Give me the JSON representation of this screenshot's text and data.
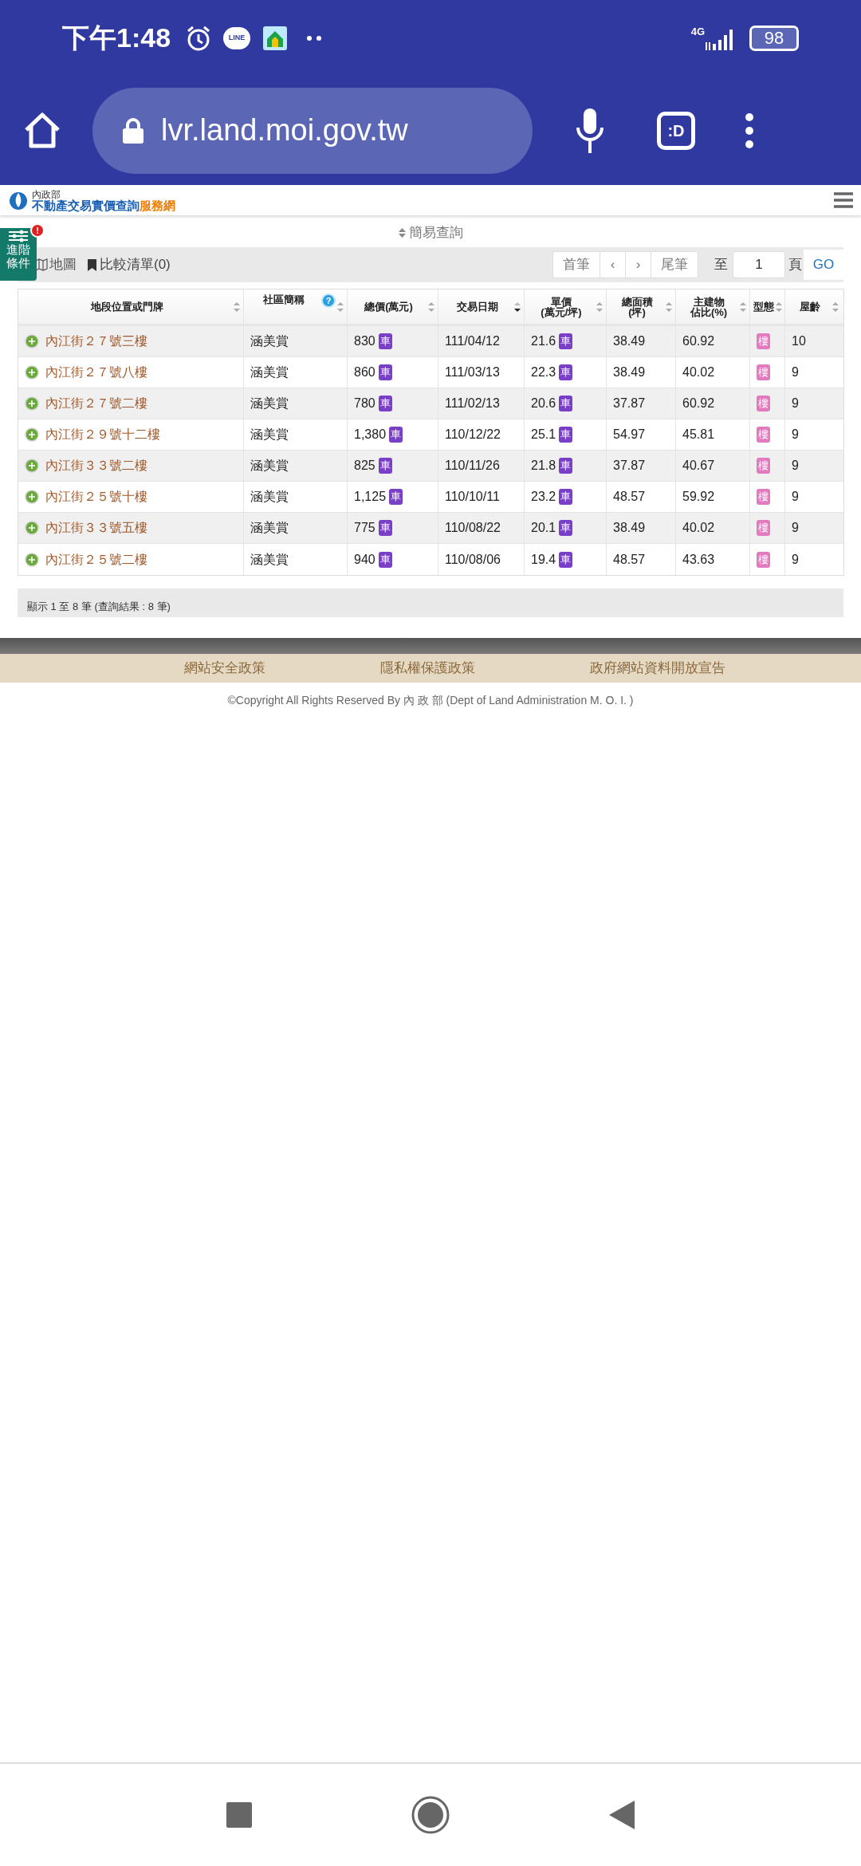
{
  "status_bar": {
    "time": "下午1:48",
    "chat_app": "LINE",
    "network": "4G",
    "battery": "98"
  },
  "browser": {
    "url": "lvr.land.moi.gov.tw",
    "tab_switcher": ":D"
  },
  "site_header": {
    "ministry": "內政部",
    "title": "不動產交易實價查詢",
    "title_suffix": "服務網"
  },
  "advanced_button": {
    "lines": [
      "進階",
      "條件"
    ],
    "alert": "!"
  },
  "simple_query": "簡易查詢",
  "toolbar": {
    "map": "地圖",
    "compare": "比較清單(0)",
    "first": "首筆",
    "prev": "‹",
    "next": "›",
    "last": "尾筆",
    "goto_label": "至",
    "page": "1",
    "page_unit": "頁",
    "go": "GO"
  },
  "table": {
    "columns": [
      {
        "lines": [
          "地段位置或門牌"
        ],
        "sorted": false
      },
      {
        "lines": [
          "社區簡稱"
        ],
        "sorted": false,
        "help": "?"
      },
      {
        "lines": [
          "總價(萬元)"
        ],
        "sorted": false
      },
      {
        "lines": [
          "交易日期"
        ],
        "sorted": true
      },
      {
        "lines": [
          "單價",
          "(萬元/坪)"
        ],
        "sorted": false
      },
      {
        "lines": [
          "總面積",
          "(坪)"
        ],
        "sorted": false
      },
      {
        "lines": [
          "主建物",
          "佔比(%)"
        ],
        "sorted": false
      },
      {
        "lines": [
          "型態"
        ],
        "sorted": false
      },
      {
        "lines": [
          "屋齡"
        ],
        "sorted": false
      }
    ],
    "rows": [
      {
        "address": "內江街２７號三樓",
        "community": "涵美賞",
        "total": "830",
        "total_badge": "車",
        "date": "111/04/12",
        "unit": "21.6",
        "unit_badge": "車",
        "area": "38.49",
        "ratio": "60.92",
        "type": "樓",
        "age": "10"
      },
      {
        "address": "內江街２７號八樓",
        "community": "涵美賞",
        "total": "860",
        "total_badge": "車",
        "date": "111/03/13",
        "unit": "22.3",
        "unit_badge": "車",
        "area": "38.49",
        "ratio": "40.02",
        "type": "樓",
        "age": "9"
      },
      {
        "address": "內江街２７號二樓",
        "community": "涵美賞",
        "total": "780",
        "total_badge": "車",
        "date": "111/02/13",
        "unit": "20.6",
        "unit_badge": "車",
        "area": "37.87",
        "ratio": "60.92",
        "type": "樓",
        "age": "9"
      },
      {
        "address": "內江街２９號十二樓",
        "community": "涵美賞",
        "total": "1,380",
        "total_badge": "車",
        "date": "110/12/22",
        "unit": "25.1",
        "unit_badge": "車",
        "area": "54.97",
        "ratio": "45.81",
        "type": "樓",
        "age": "9"
      },
      {
        "address": "內江街３３號二樓",
        "community": "涵美賞",
        "total": "825",
        "total_badge": "車",
        "date": "110/11/26",
        "unit": "21.8",
        "unit_badge": "車",
        "area": "37.87",
        "ratio": "40.67",
        "type": "樓",
        "age": "9"
      },
      {
        "address": "內江街２５號十樓",
        "community": "涵美賞",
        "total": "1,125",
        "total_badge": "車",
        "date": "110/10/11",
        "unit": "23.2",
        "unit_badge": "車",
        "area": "48.57",
        "ratio": "59.92",
        "type": "樓",
        "age": "9"
      },
      {
        "address": "內江街３３號五樓",
        "community": "涵美賞",
        "total": "775",
        "total_badge": "車",
        "date": "110/08/22",
        "unit": "20.1",
        "unit_badge": "車",
        "area": "38.49",
        "ratio": "40.02",
        "type": "樓",
        "age": "9"
      },
      {
        "address": "內江街２５號二樓",
        "community": "涵美賞",
        "total": "940",
        "total_badge": "車",
        "date": "110/08/06",
        "unit": "19.4",
        "unit_badge": "車",
        "area": "48.57",
        "ratio": "43.63",
        "type": "樓",
        "age": "9"
      }
    ],
    "summary": "顯示 1 至 8 筆 (查詢結果 : 8 筆)"
  },
  "footer": {
    "links": [
      "網站安全政策",
      "隱私權保護政策",
      "政府網站資料開放宣告"
    ],
    "copyright": "©Copyright All Rights Reserved By 內 政 部 (Dept of Land Administration M. O. I. )"
  }
}
